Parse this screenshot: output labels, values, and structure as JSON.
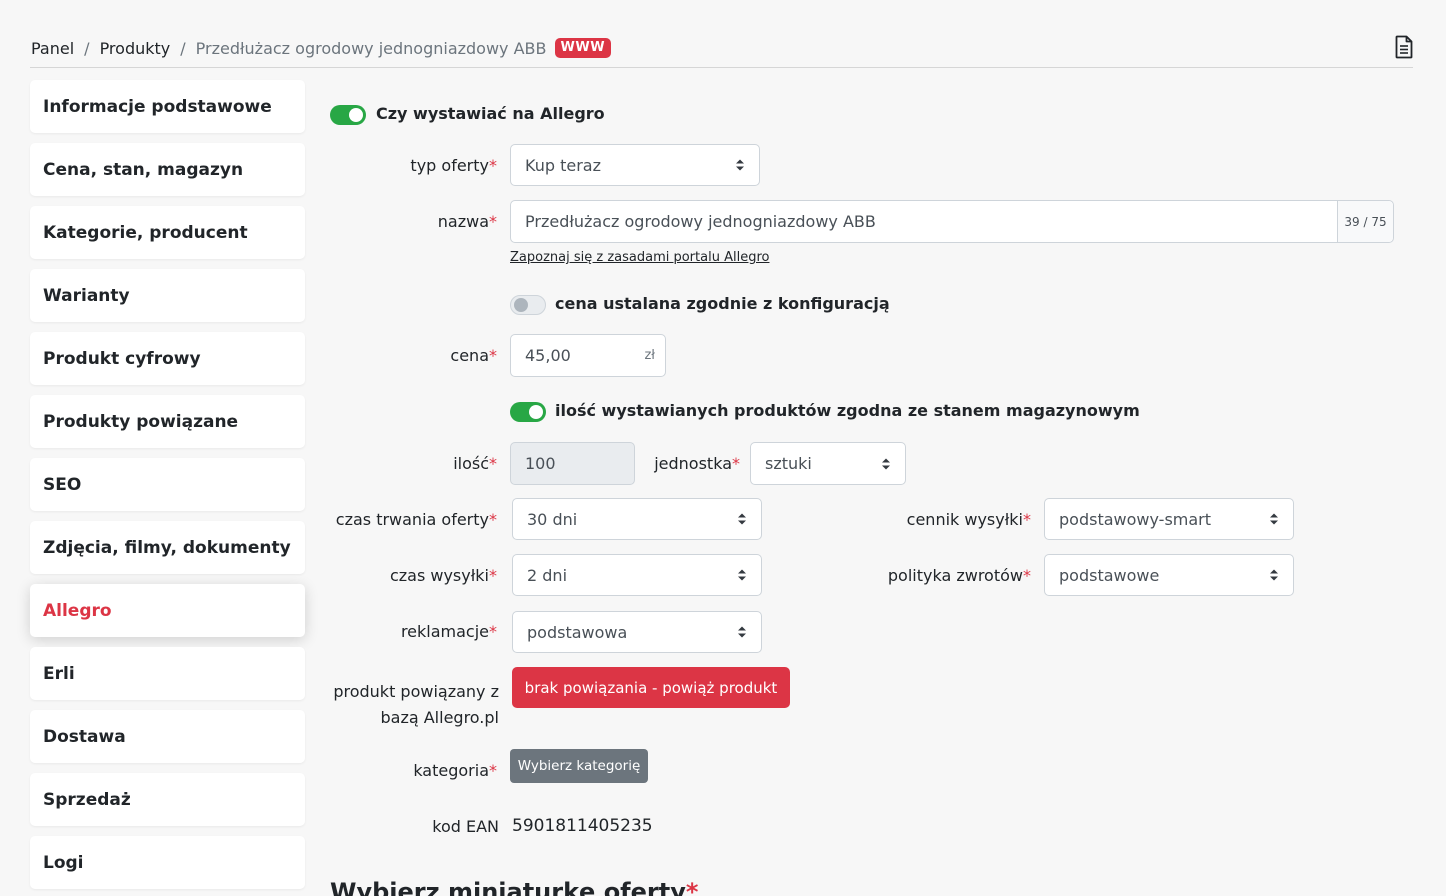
{
  "breadcrumb": {
    "home": "Panel",
    "separator": "/",
    "section": "Produkty",
    "current": "Przedłużacz ogrodowy jednogniazdowy ABB",
    "badge": "WWW"
  },
  "header": {
    "icon": "document-icon"
  },
  "sidebar": {
    "active_index": 8,
    "items": [
      {
        "label": "Informacje podstawowe"
      },
      {
        "label": "Cena, stan, magazyn"
      },
      {
        "label": "Kategorie, producent"
      },
      {
        "label": "Warianty"
      },
      {
        "label": "Produkt cyfrowy"
      },
      {
        "label": "Produkty powiązane"
      },
      {
        "label": "SEO"
      },
      {
        "label": "Zdjęcia, filmy, dokumenty"
      },
      {
        "label": "Allegro"
      },
      {
        "label": "Erli"
      },
      {
        "label": "Dostawa"
      },
      {
        "label": "Sprzedaż"
      },
      {
        "label": "Logi"
      }
    ]
  },
  "form": {
    "allegro_toggle": {
      "label": "Czy wystawiać na Allegro",
      "on": true
    },
    "required_mark": "*",
    "offer_type": {
      "label": "typ oferty",
      "value": "Kup teraz"
    },
    "name": {
      "label": "nazwa",
      "value": "Przedłużacz ogrodowy jednogniazdowy ABB",
      "counter": "39 / 75"
    },
    "rules_link": "Zapoznaj się z zasadami portalu Allegro",
    "price_config_toggle": {
      "label": "cena ustalana zgodnie z konfiguracją",
      "on": false
    },
    "price": {
      "label": "cena",
      "value": "45,00",
      "suffix": "zł"
    },
    "stock_toggle": {
      "label": "ilość wystawianych produktów zgodna ze stanem magazynowym",
      "on": true
    },
    "quantity": {
      "label": "ilość",
      "value": "100"
    },
    "unit": {
      "label": "jednostka",
      "value": "sztuki"
    },
    "duration": {
      "label": "czas trwania oferty",
      "value": "30 dni"
    },
    "shipping_price_list": {
      "label": "cennik wysyłki",
      "value": "podstawowy-smart"
    },
    "shipping_time": {
      "label": "czas wysyłki",
      "value": "2 dni"
    },
    "returns_policy": {
      "label": "polityka zwrotów",
      "value": "podstawowe"
    },
    "complaints": {
      "label": "reklamacje",
      "value": "podstawowa"
    },
    "linked_product": {
      "label_line1": "produkt powiązany z",
      "label_line2": "bazą Allegro.pl",
      "button": "brak powiązania - powiąż produkt"
    },
    "category": {
      "label": "kategoria",
      "button": "Wybierz kategorię"
    },
    "ean": {
      "label": "kod EAN",
      "value": "5901811405235"
    },
    "thumbnail_heading": "Wybierz miniaturkę oferty"
  },
  "colors": {
    "accent_red": "#dc3545",
    "toggle_green": "#28a745",
    "button_grey": "#6c757d"
  }
}
